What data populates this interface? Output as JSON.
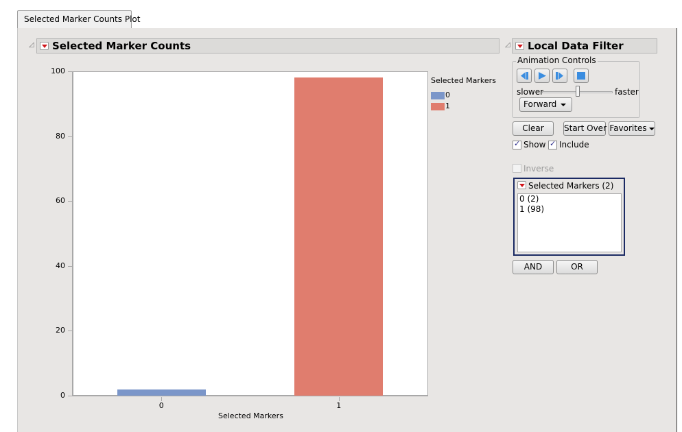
{
  "tabs": [
    {
      "label": "Selected Marker Counts Plot",
      "active": true
    }
  ],
  "report": {
    "title": "Selected Marker Counts"
  },
  "chart_data": {
    "type": "bar",
    "title": "Selected Marker Counts",
    "xlabel": "Selected Markers",
    "ylabel": "",
    "categories": [
      "0",
      "1"
    ],
    "values": [
      2,
      98
    ],
    "colors": [
      "#7b96c9",
      "#e07d6e"
    ],
    "ylim": [
      0,
      100
    ],
    "yticks": [
      0,
      20,
      40,
      60,
      80,
      100
    ],
    "grid": false,
    "legend": {
      "title": "Selected Markers",
      "placement": "right",
      "entries": [
        {
          "label": "0",
          "color": "#7b96c9"
        },
        {
          "label": "1",
          "color": "#e07d6e"
        }
      ]
    }
  },
  "filter": {
    "title": "Local Data Filter",
    "animation": {
      "group_label": "Animation Controls",
      "buttons": [
        "step-back",
        "play",
        "step-forward",
        "stop"
      ],
      "slower_label": "slower",
      "faster_label": "faster",
      "speed_fraction": 0.5,
      "direction": "Forward"
    },
    "clear_label": "Clear",
    "start_over_label": "Start Over",
    "favorites_label": "Favorites",
    "show_label": "Show",
    "show_checked": true,
    "include_label": "Include",
    "include_checked": true,
    "inverse_label": "Inverse",
    "inverse_checked": false,
    "column_filter": {
      "title": "Selected Markers (2)",
      "items": [
        "0 (2)",
        "1 (98)"
      ]
    },
    "and_label": "AND",
    "or_label": "OR"
  }
}
